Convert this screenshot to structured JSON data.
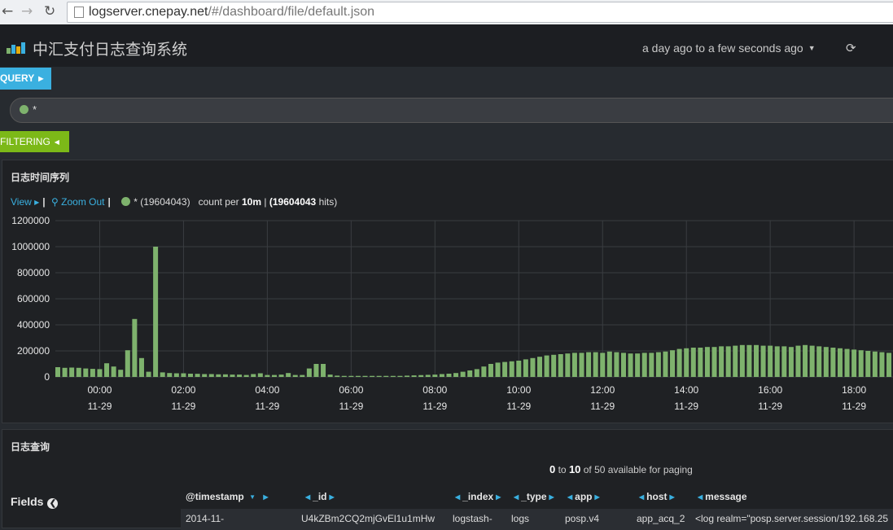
{
  "browser": {
    "url_host": "logserver.cnepay.net",
    "url_path": "/#/dashboard/file/default.json"
  },
  "header": {
    "app_title": "中汇支付日志查询系统",
    "time_range": "a day ago to a few seconds ago"
  },
  "query": {
    "tab_label": "QUERY",
    "value": "*"
  },
  "filtering": {
    "tab_label": "FILTERING"
  },
  "histogram": {
    "title": "日志时间序列",
    "view_label": "View",
    "zoom_out_label": "Zoom Out",
    "series_label": "* (19604043)",
    "count_per_prefix": "count per",
    "interval": "10m",
    "hits_total": "(19604043",
    "hits_suffix": "hits)"
  },
  "logs": {
    "title": "日志查询",
    "paging_from": "0",
    "paging_to_word": "to",
    "paging_to": "10",
    "paging_suffix": "of 50 available for paging",
    "fields_label": "Fields",
    "columns": [
      "@timestamp",
      "_id",
      "_index",
      "_type",
      "app",
      "host",
      "message"
    ],
    "row": {
      "timestamp": "2014-11-",
      "id": "U4kZBm2CQ2mjGvEl1u1mHw",
      "index": "logstash-",
      "type": "logs",
      "app": "posp.v4",
      "host": "app_acq_2",
      "message": "<log realm=\"posp.server.session/192.168.25"
    }
  },
  "chart_data": {
    "type": "bar",
    "title": "日志时间序列",
    "color": "#7eb26d",
    "ylim": [
      0,
      1200000
    ],
    "yticks": [
      0,
      200000,
      400000,
      600000,
      800000,
      1000000,
      1200000
    ],
    "xticks": [
      {
        "time": "00:00",
        "date": "11-29",
        "bar_index": 6
      },
      {
        "time": "02:00",
        "date": "11-29",
        "bar_index": 18
      },
      {
        "time": "04:00",
        "date": "11-29",
        "bar_index": 30
      },
      {
        "time": "06:00",
        "date": "11-29",
        "bar_index": 42
      },
      {
        "time": "08:00",
        "date": "11-29",
        "bar_index": 54
      },
      {
        "time": "10:00",
        "date": "11-29",
        "bar_index": 66
      },
      {
        "time": "12:00",
        "date": "11-29",
        "bar_index": 78
      },
      {
        "time": "14:00",
        "date": "11-29",
        "bar_index": 90
      },
      {
        "time": "16:00",
        "date": "11-29",
        "bar_index": 102
      },
      {
        "time": "18:00",
        "date": "11-29",
        "bar_index": 114
      }
    ],
    "grid": true,
    "values": [
      75000,
      70000,
      72000,
      70000,
      65000,
      62000,
      60000,
      105000,
      80000,
      55000,
      205000,
      445000,
      145000,
      40000,
      1000000,
      35000,
      30000,
      28000,
      28000,
      25000,
      24000,
      22000,
      22000,
      20000,
      20000,
      18000,
      18000,
      15000,
      22000,
      28000,
      15000,
      15000,
      18000,
      30000,
      15000,
      15000,
      65000,
      100000,
      100000,
      18000,
      10000,
      8000,
      8000,
      8000,
      8000,
      8000,
      8000,
      8000,
      8000,
      8000,
      10000,
      12000,
      14000,
      16000,
      18000,
      22000,
      25000,
      30000,
      40000,
      50000,
      60000,
      80000,
      100000,
      110000,
      115000,
      120000,
      125000,
      135000,
      145000,
      155000,
      165000,
      170000,
      175000,
      180000,
      185000,
      185000,
      190000,
      190000,
      185000,
      195000,
      190000,
      185000,
      180000,
      180000,
      185000,
      185000,
      190000,
      195000,
      205000,
      215000,
      220000,
      225000,
      225000,
      230000,
      230000,
      235000,
      235000,
      240000,
      245000,
      245000,
      245000,
      240000,
      240000,
      235000,
      235000,
      230000,
      240000,
      245000,
      240000,
      235000,
      230000,
      225000,
      220000,
      215000,
      210000,
      205000,
      200000,
      195000,
      190000,
      185000,
      180000,
      185000,
      190000,
      190000
    ]
  }
}
